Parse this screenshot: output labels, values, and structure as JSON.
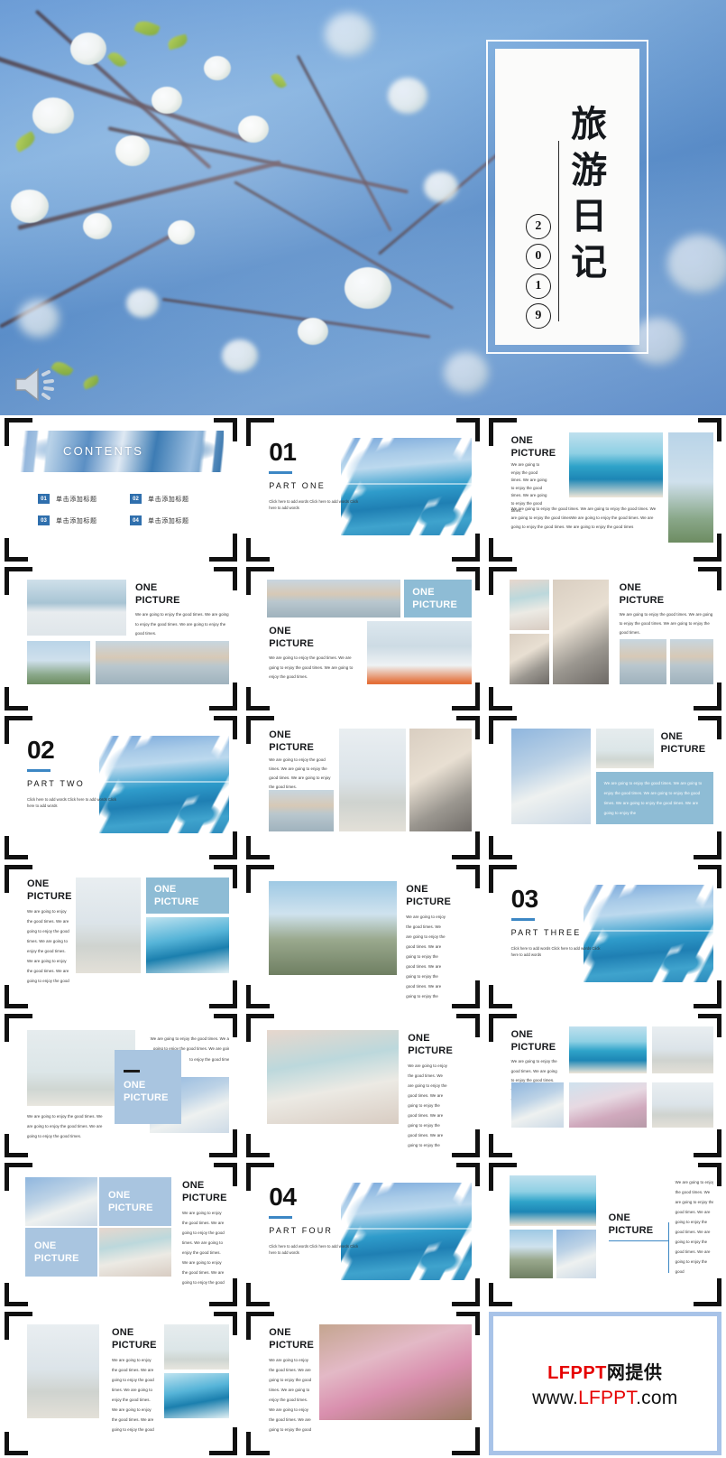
{
  "hero": {
    "title_vertical": "旅游日记",
    "year_digits": [
      "2",
      "0",
      "1",
      "9"
    ],
    "speaker_icon": "speaker-icon"
  },
  "common": {
    "one_picture_line1": "ONE",
    "one_picture_line2": "PICTURE",
    "body_short": "We are going to enjoy the good times. We are going to enjoy the good times. We are going to enjoy the good times.",
    "body_medium": "We are going to enjoy the good times. We are going to enjoy the good times. We are going to enjoy the good times. We are going to enjoy the good times. We are going to enjoy the",
    "body_long": "We are going to enjoy the good times. We are going to enjoy the good times. We are going to enjoy the good timesWe are going to enjoy the good times. We are going to enjoy the good times. We are going to enjoy the good times",
    "body_tall": "We are going to enjoy the good times. We are going to enjoy the good times. We are going to enjoy the good times. We are going to enjoy the good times. We are going to enjoy the good",
    "section_body": "Click here to add words Click here to add words Click here to add words"
  },
  "contents": {
    "title": "CONTENTS",
    "items": [
      {
        "num": "01",
        "label": "单击添加标题"
      },
      {
        "num": "02",
        "label": "单击添加标题"
      },
      {
        "num": "03",
        "label": "单击添加标题"
      },
      {
        "num": "04",
        "label": "单击添加标题"
      }
    ]
  },
  "sections": [
    {
      "num": "01",
      "label": "PART  ONE"
    },
    {
      "num": "02",
      "label": "PART  TWO"
    },
    {
      "num": "03",
      "label": "PART  THREE"
    },
    {
      "num": "04",
      "label": "PART  FOUR"
    }
  ],
  "watermark": {
    "line1_red": "LFPPT",
    "line1_cn": "网提供",
    "line2_a": "www.",
    "line2_red": "LFPPT",
    "line2_b": ".com"
  },
  "colors": {
    "accent_blue": "#8ebcd5",
    "pale_blue": "#a9c5e0",
    "badge_blue": "#2f6fad",
    "rule_blue": "#3c87c4",
    "watermark_red": "#e60000",
    "frame_black": "#111111"
  }
}
